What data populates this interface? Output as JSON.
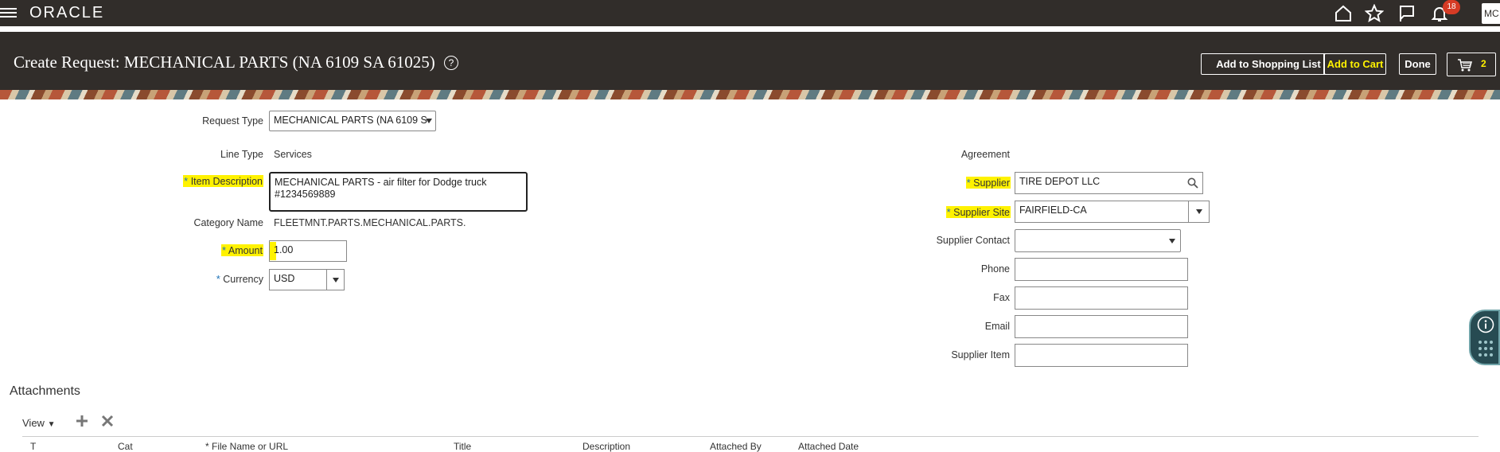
{
  "app": {
    "logo": "ORACLE",
    "notification_count": "18",
    "avatar_initials": "MC"
  },
  "header": {
    "title": "Create Request: MECHANICAL PARTS (NA 6109 SA 61025)",
    "help_symbol": "?",
    "buttons": {
      "add_to_shopping_list": "Add to Shopping List",
      "add_to_cart": "Add to Cart",
      "done": "Done"
    },
    "cart_count": "2"
  },
  "form": {
    "request_type": {
      "label": "Request Type",
      "value": "MECHANICAL PARTS (NA 6109 S"
    },
    "line_type": {
      "label": "Line Type",
      "value": "Services"
    },
    "item_description": {
      "label": "Item Description",
      "value": "MECHANICAL PARTS - air filter for Dodge truck #1234569889"
    },
    "category_name": {
      "label": "Category Name",
      "value": "FLEETMNT.PARTS.MECHANICAL.PARTS."
    },
    "amount": {
      "label": "Amount",
      "value": "1.00"
    },
    "currency": {
      "label": "Currency",
      "value": "USD"
    },
    "agreement": {
      "label": "Agreement",
      "value": ""
    },
    "supplier": {
      "label": "Supplier",
      "value": "TIRE DEPOT LLC"
    },
    "supplier_site": {
      "label": "Supplier Site",
      "value": "FAIRFIELD-CA"
    },
    "supplier_contact": {
      "label": "Supplier Contact",
      "value": ""
    },
    "phone": {
      "label": "Phone",
      "value": ""
    },
    "fax": {
      "label": "Fax",
      "value": ""
    },
    "email": {
      "label": "Email",
      "value": ""
    },
    "supplier_item": {
      "label": "Supplier Item",
      "value": ""
    },
    "required_marker": "*"
  },
  "attachments": {
    "title": "Attachments",
    "view_label": "View",
    "columns": [
      "T",
      "Cat",
      "* File Name or URL",
      "Title",
      "Description",
      "Attached By",
      "Attached Date"
    ]
  },
  "colors": {
    "header_bg": "#312d2a",
    "highlight": "#fff200",
    "required": "#1f73b7",
    "badge": "#d63b25"
  },
  "icons": {
    "menu": "hamburger-icon",
    "home": "home-icon",
    "favorites": "star-icon",
    "flag": "flag-icon",
    "notifications": "bell-icon",
    "cart": "cart-icon",
    "search": "search-icon",
    "info": "info-icon",
    "add": "plus-icon",
    "delete": "x-icon"
  }
}
